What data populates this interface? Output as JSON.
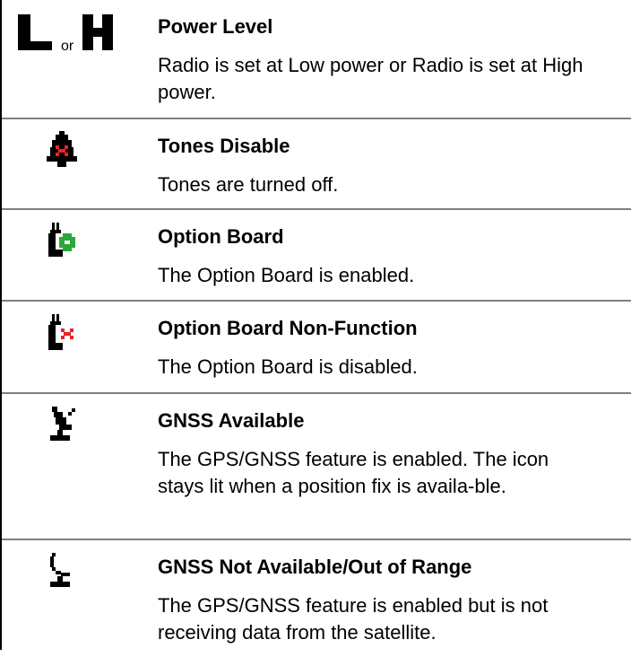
{
  "rows": [
    {
      "icon": "low-power-or-high-power-icon",
      "or_text": "or",
      "title": "Power Level",
      "desc": "Radio is set at Low power or Radio is set at High power."
    },
    {
      "icon": "tones-disable-bell-icon",
      "title": "Tones Disable",
      "desc": "Tones are turned off."
    },
    {
      "icon": "option-board-enabled-icon",
      "title": "Option Board",
      "desc": "The Option Board is enabled."
    },
    {
      "icon": "option-board-disabled-icon",
      "title": "Option Board Non-Function",
      "desc": "The Option Board is disabled."
    },
    {
      "icon": "gnss-available-satellite-dish-icon",
      "title": "GNSS Available",
      "desc": "The GPS/GNSS feature is enabled. The icon stays lit when a position fix is availa-ble."
    },
    {
      "icon": "gnss-not-available-satellite-dish-icon",
      "title": "GNSS Not Available/Out of Range",
      "desc": "The GPS/GNSS feature is enabled but is not receiving data from the satellite."
    }
  ],
  "colors": {
    "icon_red": "#e8232a",
    "icon_green": "#2aa83a",
    "divider": "#7f7f7f"
  }
}
